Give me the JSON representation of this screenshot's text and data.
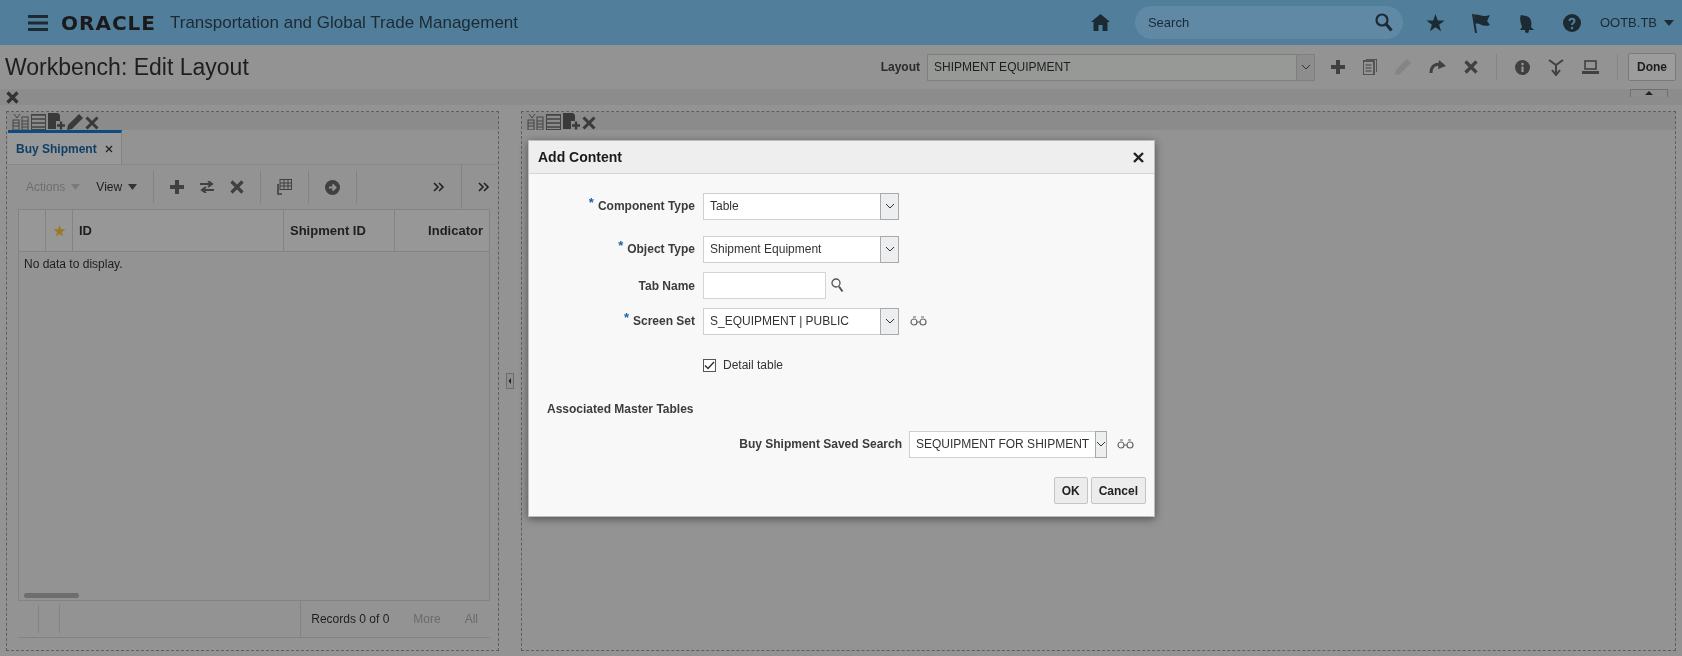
{
  "header": {
    "logo": "ORACLE",
    "product": "Transportation and Global Trade Management",
    "search": {
      "placeholder": "Search"
    },
    "user": "OOTB.TB"
  },
  "page": {
    "title": "Workbench: Edit Layout",
    "layout_label": "Layout",
    "layout_value": "SHIPMENT EQUIPMENT",
    "done": "Done"
  },
  "left_panel": {
    "tabs": [
      {
        "label": "Buy Shipment",
        "selected": true
      }
    ],
    "toolbar": [
      {
        "label": "Actions",
        "disabled": true
      },
      {
        "label": "View",
        "disabled": false
      }
    ],
    "table": {
      "columns": [
        "ID",
        "Shipment ID",
        "Indicator"
      ],
      "empty_message": "No data to display."
    },
    "footer": {
      "records": "Records 0 of 0",
      "links": [
        {
          "label": "More",
          "disabled": true
        },
        {
          "label": "All",
          "disabled": true
        }
      ]
    }
  },
  "dialog": {
    "title": "Add Content",
    "required_mark": "*",
    "fields": [
      {
        "label": "Component Type",
        "required": true,
        "kind": "select",
        "value": "Table"
      },
      {
        "label": "Object Type",
        "required": true,
        "kind": "select",
        "value": "Shipment Equipment"
      },
      {
        "label": "Tab Name",
        "kind": "search"
      },
      {
        "label": "Screen Set",
        "required": true,
        "kind": "select",
        "value": "S_EQUIPMENT | PUBLIC",
        "preview": true
      }
    ],
    "detail_table": {
      "label": "Detail table",
      "checked": true
    },
    "section": "Associated Master Tables",
    "master_fields": [
      {
        "label": "Buy Shipment Saved Search",
        "value": "SEQUIPMENT FOR SHIPMENT",
        "preview": true
      }
    ],
    "buttons": [
      {
        "label": "OK"
      },
      {
        "label": "Cancel"
      }
    ]
  }
}
